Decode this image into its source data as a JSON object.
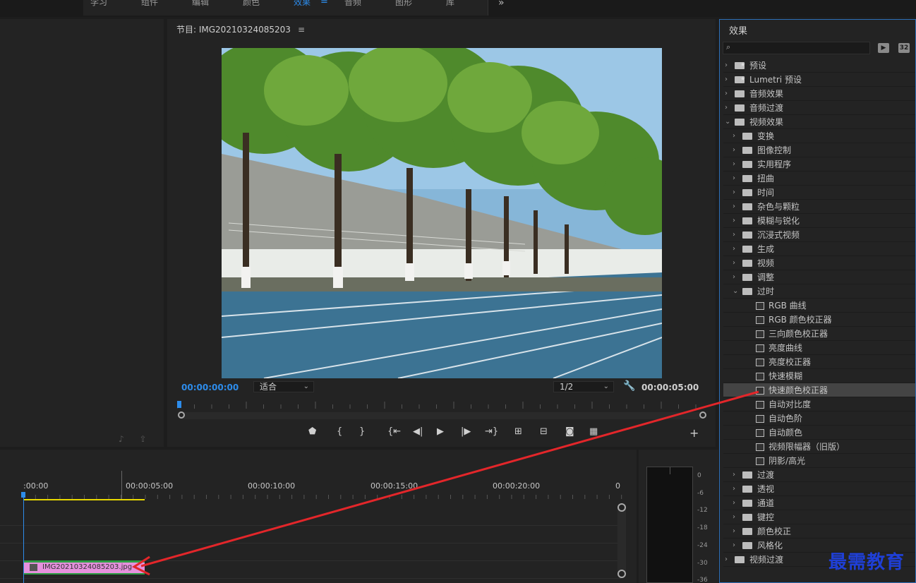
{
  "workspace_tabs": [
    {
      "label": "学习",
      "active": false
    },
    {
      "label": "组件",
      "active": false
    },
    {
      "label": "编辑",
      "active": false
    },
    {
      "label": "颜色",
      "active": false
    },
    {
      "label": "效果",
      "active": true
    },
    {
      "label": "音频",
      "active": false
    },
    {
      "label": "图形",
      "active": false
    },
    {
      "label": "库",
      "active": false
    }
  ],
  "workspace_menu_glyph": "≡",
  "workspace_more_glyph": "»",
  "program_monitor": {
    "title": "节目: IMG20210324085203",
    "menu_glyph": "≡",
    "timecode_current": "00:00:00:00",
    "timecode_duration": "00:00:05:00",
    "fit_value": "适合",
    "resolution_value": "1/2",
    "transport_buttons": [
      "marker",
      "in-point",
      "out-point",
      "go-to-in",
      "step-back",
      "play",
      "step-forward",
      "go-to-out",
      "insert",
      "overwrite",
      "export-frame",
      "comparison"
    ],
    "add_glyph": "+"
  },
  "timeline": {
    "ruler_labels": [
      ":00:00",
      "00:00:05:00",
      "00:00:10:00",
      "00:00:15:00",
      "00:00:20:00",
      "0"
    ],
    "clip_name": "IMG20210324085203.jpg"
  },
  "audio_meter": {
    "labels": [
      "0",
      "-6",
      "-12",
      "-18",
      "-24",
      "-30",
      "-36"
    ]
  },
  "effects_panel": {
    "title": "效果",
    "search_placeholder": "",
    "icon_labels": [
      "32"
    ],
    "tree": [
      {
        "label": "预设",
        "level": 0,
        "type": "folder-star",
        "expanded": false
      },
      {
        "label": "Lumetri 预设",
        "level": 0,
        "type": "folder-star",
        "expanded": false
      },
      {
        "label": "音频效果",
        "level": 0,
        "type": "folder",
        "expanded": false
      },
      {
        "label": "音频过渡",
        "level": 0,
        "type": "folder",
        "expanded": false
      },
      {
        "label": "视频效果",
        "level": 0,
        "type": "folder",
        "expanded": true
      },
      {
        "label": "变换",
        "level": 1,
        "type": "folder",
        "expanded": false
      },
      {
        "label": "图像控制",
        "level": 1,
        "type": "folder",
        "expanded": false
      },
      {
        "label": "实用程序",
        "level": 1,
        "type": "folder",
        "expanded": false
      },
      {
        "label": "扭曲",
        "level": 1,
        "type": "folder",
        "expanded": false
      },
      {
        "label": "时间",
        "level": 1,
        "type": "folder",
        "expanded": false
      },
      {
        "label": "杂色与颗粒",
        "level": 1,
        "type": "folder",
        "expanded": false
      },
      {
        "label": "模糊与锐化",
        "level": 1,
        "type": "folder",
        "expanded": false
      },
      {
        "label": "沉浸式视频",
        "level": 1,
        "type": "folder",
        "expanded": false
      },
      {
        "label": "生成",
        "level": 1,
        "type": "folder",
        "expanded": false
      },
      {
        "label": "视频",
        "level": 1,
        "type": "folder",
        "expanded": false
      },
      {
        "label": "调整",
        "level": 1,
        "type": "folder",
        "expanded": false
      },
      {
        "label": "过时",
        "level": 1,
        "type": "folder",
        "expanded": true
      },
      {
        "label": "RGB 曲线",
        "level": 2,
        "type": "effect"
      },
      {
        "label": "RGB 颜色校正器",
        "level": 2,
        "type": "effect"
      },
      {
        "label": "三向颜色校正器",
        "level": 2,
        "type": "effect"
      },
      {
        "label": "亮度曲线",
        "level": 2,
        "type": "effect"
      },
      {
        "label": "亮度校正器",
        "level": 2,
        "type": "effect"
      },
      {
        "label": "快速模糊",
        "level": 2,
        "type": "effect"
      },
      {
        "label": "快速颜色校正器",
        "level": 2,
        "type": "effect",
        "highlight": true
      },
      {
        "label": "自动对比度",
        "level": 2,
        "type": "effect"
      },
      {
        "label": "自动色阶",
        "level": 2,
        "type": "effect"
      },
      {
        "label": "自动颜色",
        "level": 2,
        "type": "effect"
      },
      {
        "label": "视频限幅器（旧版）",
        "level": 2,
        "type": "effect"
      },
      {
        "label": "阴影/高光",
        "level": 2,
        "type": "effect"
      },
      {
        "label": "过渡",
        "level": 1,
        "type": "folder",
        "expanded": false
      },
      {
        "label": "透视",
        "level": 1,
        "type": "folder",
        "expanded": false
      },
      {
        "label": "通道",
        "level": 1,
        "type": "folder",
        "expanded": false
      },
      {
        "label": "键控",
        "level": 1,
        "type": "folder",
        "expanded": false
      },
      {
        "label": "颜色校正",
        "level": 1,
        "type": "folder",
        "expanded": false
      },
      {
        "label": "风格化",
        "level": 1,
        "type": "folder",
        "expanded": false
      },
      {
        "label": "视频过渡",
        "level": 0,
        "type": "folder",
        "expanded": false
      }
    ]
  },
  "watermark": "最需教育",
  "colors": {
    "accent": "#2d8ceb",
    "annotation_arrow": "#e3262a",
    "clip": "#e591dd",
    "watermark": "#1f3fd6"
  }
}
